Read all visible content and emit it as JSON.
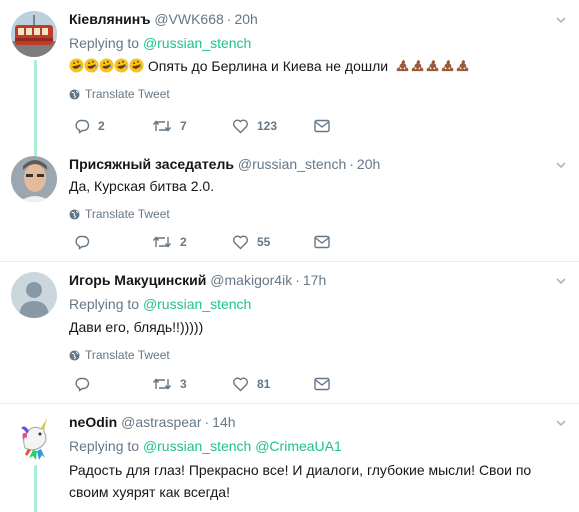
{
  "reply_prefix": "Replying to",
  "translate_label": "Translate Tweet",
  "tweets": [
    {
      "name": "Кіевлянинъ",
      "handle": "@VWK668",
      "time": "20h",
      "reply_to": "@russian_stench",
      "reply_to_2": "",
      "text": "Опять до Берлина и Киева не дошли",
      "replies": "2",
      "retweets": "7",
      "likes": "123"
    },
    {
      "name": "Присяжный заседатель",
      "handle": "@russian_stench",
      "time": "20h",
      "reply_to": "",
      "reply_to_2": "",
      "text": "Да, Курская битва 2.0.",
      "replies": "",
      "retweets": "2",
      "likes": "55"
    },
    {
      "name": "Игорь Макуцинский",
      "handle": "@makigor4ik",
      "time": "17h",
      "reply_to": "@russian_stench",
      "reply_to_2": "",
      "text": "Дави его, блядь!!)))))",
      "replies": "",
      "retweets": "3",
      "likes": "81"
    },
    {
      "name": "neOdin",
      "handle": "@astraspear",
      "time": "14h",
      "reply_to": "@russian_stench",
      "reply_to_2": "@CrimeaUA1",
      "text": "Радость для глаз! Прекрасно все! И диалоги, глубокие мысли! Свои по своим хуярят как всегда!",
      "replies": "",
      "retweets": "",
      "likes": ""
    }
  ],
  "colors": {
    "accent": "#1fc28a",
    "thread_line": "#a9efd2",
    "muted": "#657786",
    "divider": "#e6ecf0"
  }
}
